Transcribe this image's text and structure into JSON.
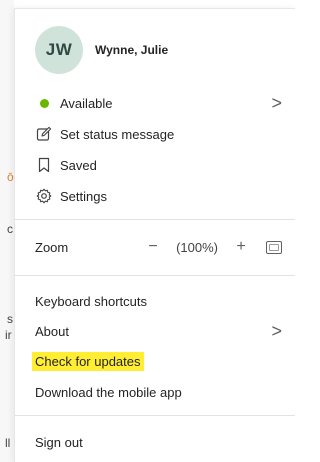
{
  "background": {
    "chars": [
      {
        "text": "ō",
        "orange": true
      },
      {
        "text": "c",
        "orange": false
      },
      {
        "text": "s",
        "orange": false
      },
      {
        "text": "ir",
        "orange": false
      },
      {
        "text": "ll",
        "orange": false
      }
    ]
  },
  "profile": {
    "initials": "JW",
    "name": "Wynne, Julie",
    "avatar_color": "#cfe3db"
  },
  "menu": {
    "status": {
      "label": "Available",
      "color": "#6bb700",
      "chevron": ">"
    },
    "set_status": {
      "label": "Set status message",
      "icon": "edit-icon"
    },
    "saved": {
      "label": "Saved",
      "icon": "bookmark-icon"
    },
    "settings": {
      "label": "Settings",
      "icon": "gear-icon"
    },
    "zoom": {
      "label": "Zoom",
      "minus": "−",
      "value": "(100%)",
      "plus": "+",
      "fit_icon": "fit-to-screen-icon"
    },
    "keyboard_shortcuts": {
      "label": "Keyboard shortcuts"
    },
    "about": {
      "label": "About",
      "chevron": ">"
    },
    "check_updates": {
      "label": "Check for updates",
      "highlight_color": "#ffee33"
    },
    "download_mobile": {
      "label": "Download the mobile app"
    },
    "sign_out": {
      "label": "Sign out"
    }
  }
}
